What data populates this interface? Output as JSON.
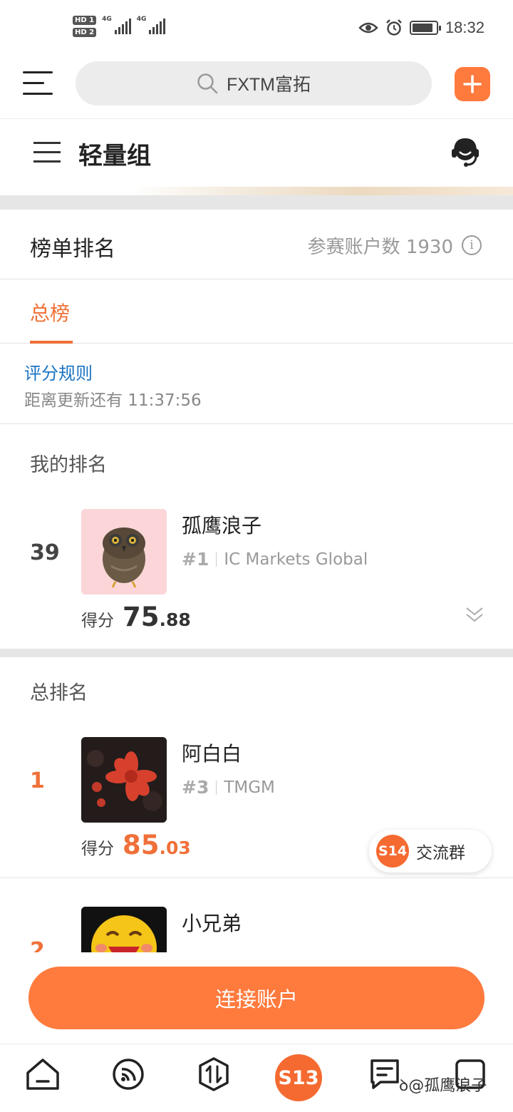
{
  "status_bar": {
    "sim1": "HD 1",
    "sim2": "HD 2",
    "network1": "4G",
    "network2": "4G",
    "time": "18:32"
  },
  "top_bar": {
    "search_text": "FXTM富拓",
    "plus_label": "+"
  },
  "group_bar": {
    "title": "轻量组"
  },
  "leaderboard": {
    "title": "榜单排名",
    "participants": "参赛账户数 1930",
    "info_glyph": "i",
    "tabs": [
      {
        "label": "总榜",
        "active": true
      }
    ],
    "rules_link": "评分规则",
    "countdown": "距离更新还有 11:37:56"
  },
  "my_rank": {
    "section_title": "我的排名",
    "rank": "39",
    "name": "孤鹰浪子",
    "tag_num": "#1",
    "broker": "IC Markets Global",
    "score_label": "得分",
    "score_int": "75",
    "score_dec": ".88"
  },
  "overall": {
    "section_title": "总排名",
    "entries": [
      {
        "rank": "1",
        "name": "阿白白",
        "tag_num": "#3",
        "broker": "TMGM",
        "score_label": "得分",
        "score_int": "85",
        "score_dec": ".03"
      },
      {
        "rank": "2",
        "name": "小兄弟"
      }
    ]
  },
  "float_chip": {
    "badge": "S14",
    "label": "交流群"
  },
  "cta": {
    "label": "连接账户"
  },
  "tab_bar": {
    "center_badge": "S13",
    "watermark": "@孤鹰浪子"
  },
  "colors": {
    "accent": "#ff7a3d",
    "rank_accent": "#f07038",
    "link": "#1a73c2",
    "divider": "#e6e6e6"
  },
  "icons": [
    "menu-icon",
    "search-icon",
    "plus-icon",
    "customer-service-icon",
    "info-icon",
    "chevron-down-icon",
    "home-icon",
    "signal-icon",
    "trade-icon",
    "message-icon",
    "square-icon"
  ]
}
